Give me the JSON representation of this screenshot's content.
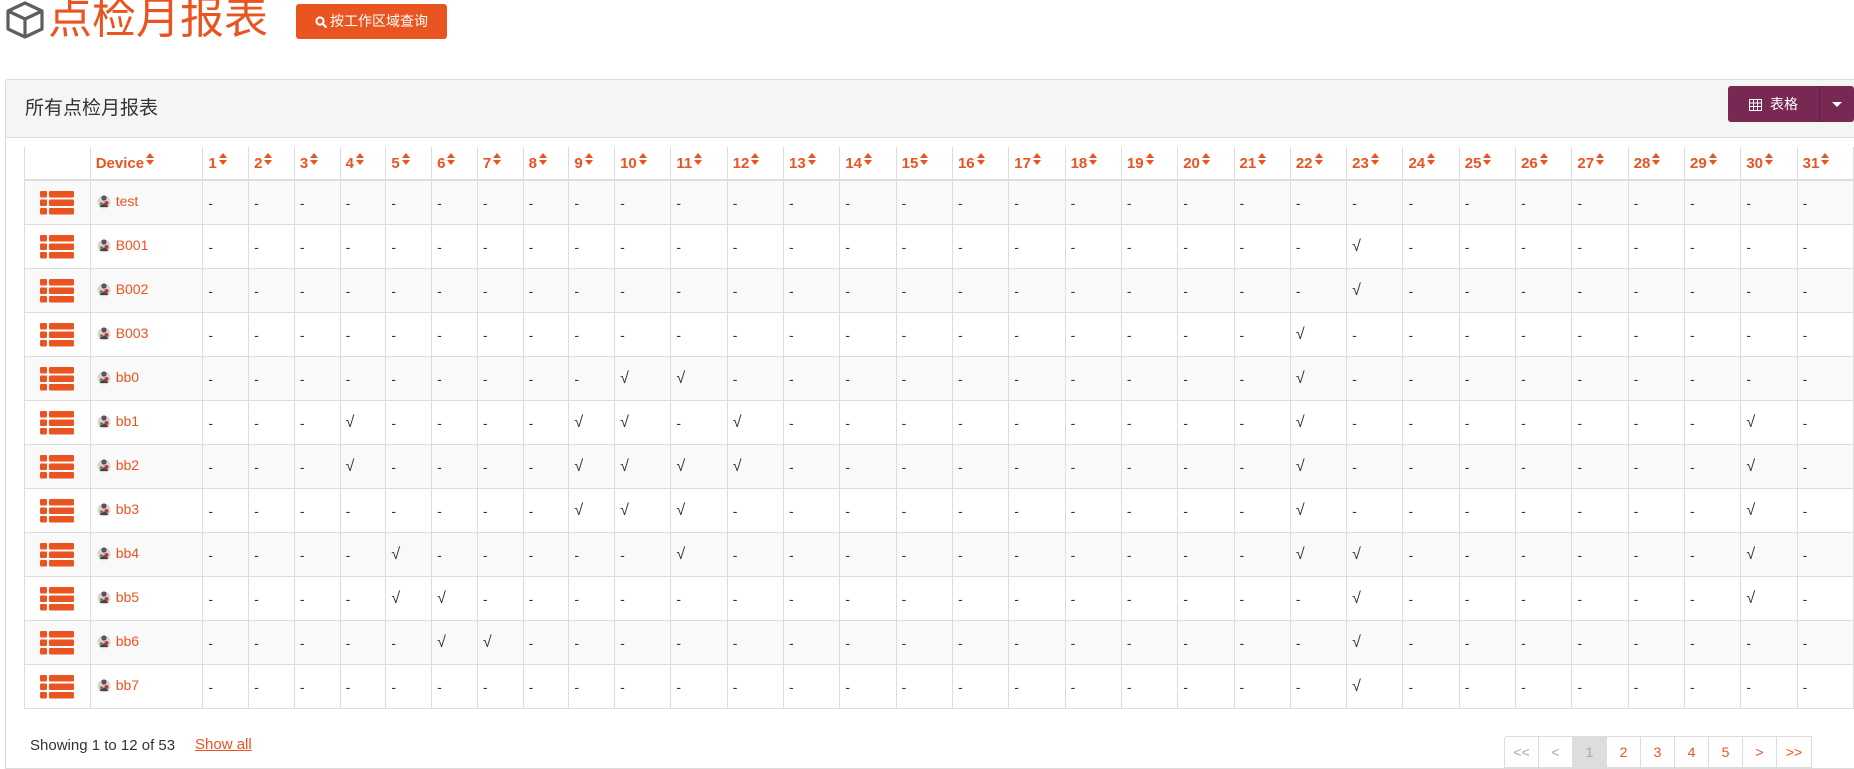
{
  "header": {
    "title": "点检月报表",
    "query_button": "按工作区域查询"
  },
  "panel": {
    "title": "所有点检月报表",
    "view_button": "表格"
  },
  "table": {
    "columns": [
      "Device",
      "1",
      "2",
      "3",
      "4",
      "5",
      "6",
      "7",
      "8",
      "9",
      "10",
      "11",
      "12",
      "13",
      "14",
      "15",
      "16",
      "17",
      "18",
      "19",
      "20",
      "21",
      "22",
      "23",
      "24",
      "25",
      "26",
      "27",
      "28",
      "29",
      "30",
      "31"
    ],
    "rows": [
      {
        "device": "test",
        "days": [
          "-",
          "-",
          "-",
          "-",
          "-",
          "-",
          "-",
          "-",
          "-",
          "-",
          "-",
          "-",
          "-",
          "-",
          "-",
          "-",
          "-",
          "-",
          "-",
          "-",
          "-",
          "-",
          "-",
          "-",
          "-",
          "-",
          "-",
          "-",
          "-",
          "-",
          "-"
        ]
      },
      {
        "device": "B001",
        "days": [
          "-",
          "-",
          "-",
          "-",
          "-",
          "-",
          "-",
          "-",
          "-",
          "-",
          "-",
          "-",
          "-",
          "-",
          "-",
          "-",
          "-",
          "-",
          "-",
          "-",
          "-",
          "-",
          "√",
          "-",
          "-",
          "-",
          "-",
          "-",
          "-",
          "-",
          "-"
        ]
      },
      {
        "device": "B002",
        "days": [
          "-",
          "-",
          "-",
          "-",
          "-",
          "-",
          "-",
          "-",
          "-",
          "-",
          "-",
          "-",
          "-",
          "-",
          "-",
          "-",
          "-",
          "-",
          "-",
          "-",
          "-",
          "-",
          "√",
          "-",
          "-",
          "-",
          "-",
          "-",
          "-",
          "-",
          "-"
        ]
      },
      {
        "device": "B003",
        "days": [
          "-",
          "-",
          "-",
          "-",
          "-",
          "-",
          "-",
          "-",
          "-",
          "-",
          "-",
          "-",
          "-",
          "-",
          "-",
          "-",
          "-",
          "-",
          "-",
          "-",
          "-",
          "√",
          "-",
          "-",
          "-",
          "-",
          "-",
          "-",
          "-",
          "-",
          "-"
        ]
      },
      {
        "device": "bb0",
        "days": [
          "-",
          "-",
          "-",
          "-",
          "-",
          "-",
          "-",
          "-",
          "-",
          "√",
          "√",
          "-",
          "-",
          "-",
          "-",
          "-",
          "-",
          "-",
          "-",
          "-",
          "-",
          "√",
          "-",
          "-",
          "-",
          "-",
          "-",
          "-",
          "-",
          "-",
          "-"
        ]
      },
      {
        "device": "bb1",
        "days": [
          "-",
          "-",
          "-",
          "√",
          "-",
          "-",
          "-",
          "-",
          "√",
          "√",
          "-",
          "√",
          "-",
          "-",
          "-",
          "-",
          "-",
          "-",
          "-",
          "-",
          "-",
          "√",
          "-",
          "-",
          "-",
          "-",
          "-",
          "-",
          "-",
          "√",
          "-"
        ]
      },
      {
        "device": "bb2",
        "days": [
          "-",
          "-",
          "-",
          "√",
          "-",
          "-",
          "-",
          "-",
          "√",
          "√",
          "√",
          "√",
          "-",
          "-",
          "-",
          "-",
          "-",
          "-",
          "-",
          "-",
          "-",
          "√",
          "-",
          "-",
          "-",
          "-",
          "-",
          "-",
          "-",
          "√",
          "-"
        ]
      },
      {
        "device": "bb3",
        "days": [
          "-",
          "-",
          "-",
          "-",
          "-",
          "-",
          "-",
          "-",
          "√",
          "√",
          "√",
          "-",
          "-",
          "-",
          "-",
          "-",
          "-",
          "-",
          "-",
          "-",
          "-",
          "√",
          "-",
          "-",
          "-",
          "-",
          "-",
          "-",
          "-",
          "√",
          "-"
        ]
      },
      {
        "device": "bb4",
        "days": [
          "-",
          "-",
          "-",
          "-",
          "√",
          "-",
          "-",
          "-",
          "-",
          "-",
          "√",
          "-",
          "-",
          "-",
          "-",
          "-",
          "-",
          "-",
          "-",
          "-",
          "-",
          "√",
          "√",
          "-",
          "-",
          "-",
          "-",
          "-",
          "-",
          "√",
          "-"
        ]
      },
      {
        "device": "bb5",
        "days": [
          "-",
          "-",
          "-",
          "-",
          "√",
          "√",
          "-",
          "-",
          "-",
          "-",
          "-",
          "-",
          "-",
          "-",
          "-",
          "-",
          "-",
          "-",
          "-",
          "-",
          "-",
          "-",
          "√",
          "-",
          "-",
          "-",
          "-",
          "-",
          "-",
          "√",
          "-"
        ]
      },
      {
        "device": "bb6",
        "days": [
          "-",
          "-",
          "-",
          "-",
          "-",
          "√",
          "√",
          "-",
          "-",
          "-",
          "-",
          "-",
          "-",
          "-",
          "-",
          "-",
          "-",
          "-",
          "-",
          "-",
          "-",
          "-",
          "√",
          "-",
          "-",
          "-",
          "-",
          "-",
          "-",
          "-",
          "-"
        ]
      },
      {
        "device": "bb7",
        "days": [
          "-",
          "-",
          "-",
          "-",
          "-",
          "-",
          "-",
          "-",
          "-",
          "-",
          "-",
          "-",
          "-",
          "-",
          "-",
          "-",
          "-",
          "-",
          "-",
          "-",
          "-",
          "-",
          "√",
          "-",
          "-",
          "-",
          "-",
          "-",
          "-",
          "-",
          "-"
        ]
      }
    ]
  },
  "footer": {
    "info": "Showing 1 to 12 of 53",
    "show_all": "Show all",
    "pagination": [
      "<<",
      "<",
      "1",
      "2",
      "3",
      "4",
      "5",
      ">",
      ">>"
    ],
    "active_page": "1"
  },
  "colors": {
    "primary": "#e95420",
    "secondary": "#772953"
  },
  "icons": {
    "page": "cube-icon",
    "query": "search-icon",
    "view": "table-icon",
    "row_menu": "list-icon",
    "device": "device-icon"
  }
}
